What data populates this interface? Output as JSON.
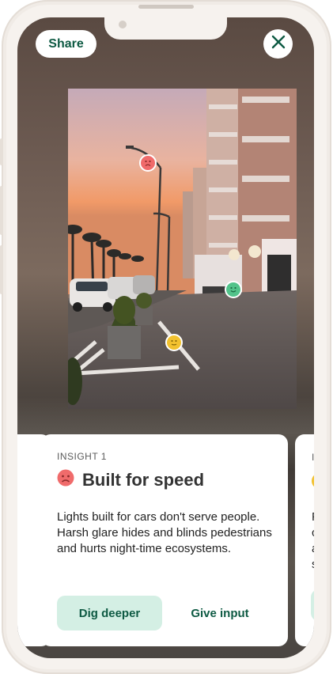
{
  "header": {
    "share_label": "Share",
    "close_icon": "close-icon"
  },
  "photo": {
    "markers": [
      {
        "mood": "sad",
        "color": "#f06b6b"
      },
      {
        "mood": "happy",
        "color": "#52c38a"
      },
      {
        "mood": "neutral",
        "color": "#f2c12e"
      }
    ]
  },
  "card": {
    "eyebrow": "INSIGHT 1",
    "title": "Built for speed",
    "mood_icon": "sad-face-icon",
    "mood_color": "#f06b6b",
    "body": "Lights built for cars don't serve people. Harsh glare hides and blinds pedestrians and hurts night-time ecosystems.",
    "primary_label": "Dig deeper",
    "secondary_label": "Give input"
  },
  "next_card": {
    "eyebrow": "I",
    "lines": [
      "F",
      "c",
      "a",
      "s"
    ]
  },
  "colors": {
    "brand_green": "#0e5a43",
    "button_mint": "#d4efe4"
  }
}
